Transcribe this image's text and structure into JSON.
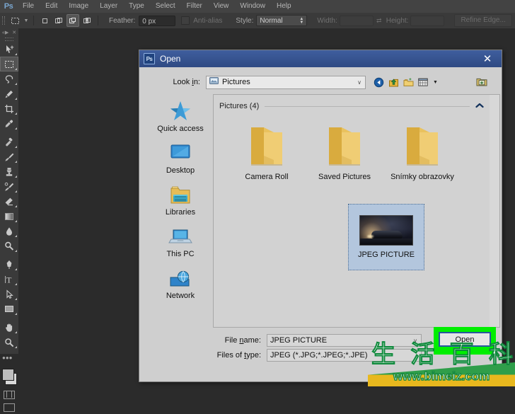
{
  "app": {
    "logo": "Ps",
    "menu": [
      "File",
      "Edit",
      "Image",
      "Layer",
      "Type",
      "Select",
      "Filter",
      "View",
      "Window",
      "Help"
    ]
  },
  "options_bar": {
    "tool_icon": "rectangular-marquee-icon",
    "feather_label": "Feather:",
    "feather_value": "0 px",
    "antialias_label": "Anti-alias",
    "style_label": "Style:",
    "style_value": "Normal",
    "width_label": "Width:",
    "width_value": "",
    "height_label": "Height:",
    "height_value": "",
    "refine_edge_label": "Refine Edge..."
  },
  "toolbar": {
    "tools": [
      "move-tool",
      "rectangular-marquee-tool",
      "lasso-tool",
      "quick-selection-tool",
      "crop-tool",
      "eyedropper-tool",
      "spot-healing-brush-tool",
      "brush-tool",
      "clone-stamp-tool",
      "history-brush-tool",
      "eraser-tool",
      "gradient-tool",
      "blur-tool",
      "dodge-tool",
      "pen-tool",
      "horizontal-type-tool",
      "path-selection-tool",
      "rectangle-tool",
      "hand-tool",
      "zoom-tool"
    ]
  },
  "dialog": {
    "title": "Open",
    "title_icon": "Ps",
    "close_icon": "✕",
    "lookin": {
      "label": "Look in:",
      "label_accesskey": "i",
      "value": "Pictures",
      "folder_icon": "pictures-folder-icon",
      "chevron_icon": "∨",
      "nav_icons": [
        "back-icon",
        "up-one-level-icon",
        "create-new-folder-icon",
        "views-icon"
      ],
      "views_caret": "▼",
      "new_folder_icon": "new-folder-icon"
    },
    "places": [
      {
        "label": "Quick access",
        "icon": "quick-access-star-icon"
      },
      {
        "label": "Desktop",
        "icon": "desktop-monitor-icon"
      },
      {
        "label": "Libraries",
        "icon": "libraries-folder-icon"
      },
      {
        "label": "This PC",
        "icon": "this-pc-laptop-icon"
      },
      {
        "label": "Network",
        "icon": "network-globe-icon"
      }
    ],
    "filelist": {
      "group_title": "Pictures (4)",
      "group_chevron": "⌃",
      "folders": [
        {
          "name": "Camera Roll",
          "icon": "folder-icon"
        },
        {
          "name": "Saved Pictures",
          "icon": "folder-icon"
        },
        {
          "name": "Snímky obrazovky",
          "icon": "folder-icon"
        }
      ],
      "selected_file": {
        "name": "JPEG PICTURE",
        "icon": "jpeg-thumbnail"
      }
    },
    "file_name": {
      "label": "File name:",
      "value": "JPEG PICTURE",
      "chevron_icon": "∨"
    },
    "files_of_type": {
      "label": "Files of type:",
      "value": "JPEG (*.JPG;*.JPEG;*.JPE)"
    },
    "open_button": {
      "label": "Open",
      "accesskey": "O",
      "highlight_color": "#00ee00"
    }
  },
  "watermark": {
    "cjk_text": [
      "生",
      "活",
      "百",
      "科"
    ],
    "url": "www.bimeiz.com"
  }
}
